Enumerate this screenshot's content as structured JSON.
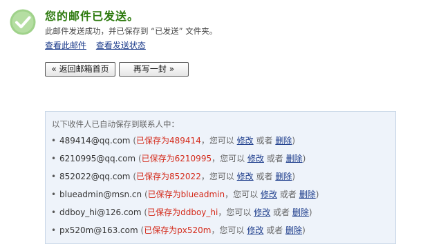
{
  "status": {
    "title": "您的邮件已发送。",
    "subtitle": "此邮件发送成功，并已保存到 “已发送” 文件夹。",
    "icon": "success-check-icon",
    "icon_color": "#9fd28a",
    "title_color": "#2d7a0e"
  },
  "links": {
    "view_mail": "查看此邮件",
    "view_status": "查看发送状态"
  },
  "buttons": {
    "back": "« 返回邮箱首页",
    "rewrite": "再写一封 »"
  },
  "contacts": {
    "header": "以下收件人已自动保存到联系人中：",
    "open_paren": "(",
    "close_paren": ")",
    "you_can": "，您可以",
    "or": "或者",
    "edit_label": "修改",
    "delete_label": "删除",
    "items": [
      {
        "email": "489414@qq.com",
        "saved_as": "已保存为489414"
      },
      {
        "email": "6210995@qq.com",
        "saved_as": "已保存为6210995"
      },
      {
        "email": "852022@qq.com",
        "saved_as": "已保存为852022"
      },
      {
        "email": "blueadmin@msn.cn",
        "saved_as": "已保存为blueadmin"
      },
      {
        "email": "ddboy_hi@126.com",
        "saved_as": "已保存为ddboy_hi"
      },
      {
        "email": "px520m@163.com",
        "saved_as": "已保存为px520m"
      }
    ]
  }
}
